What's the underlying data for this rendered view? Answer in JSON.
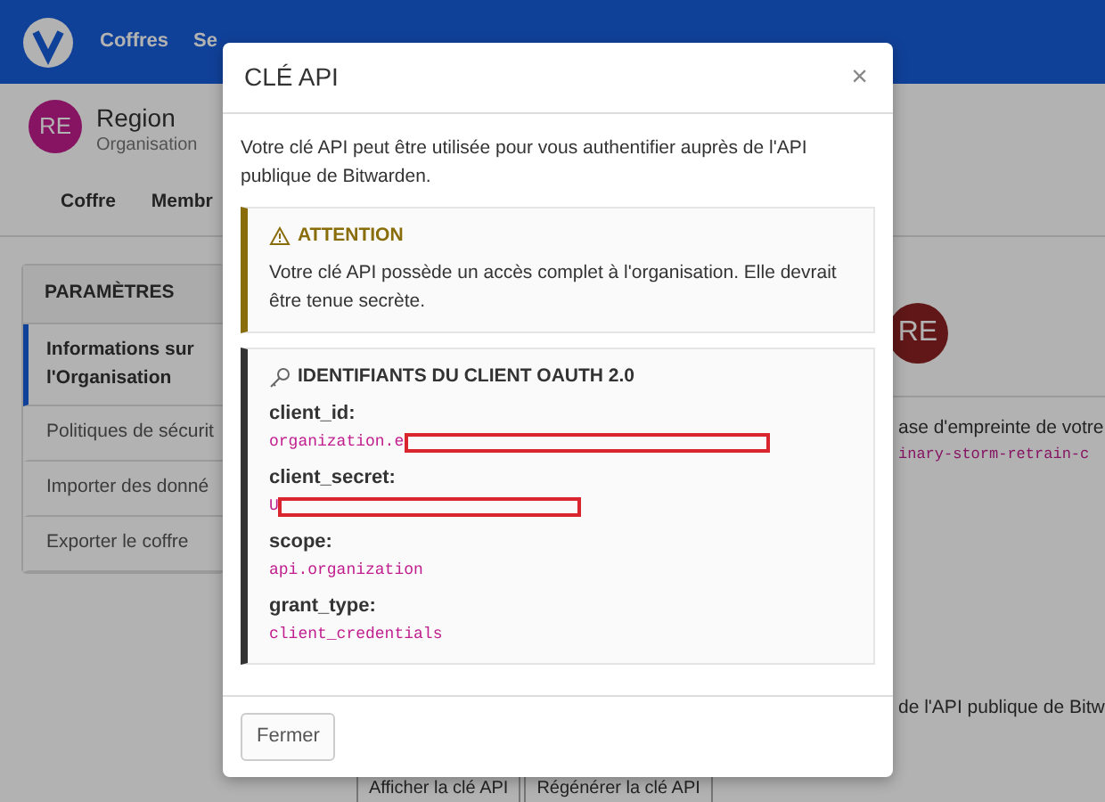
{
  "nav": {
    "items": [
      {
        "label": "Coffres"
      },
      {
        "label": "Se"
      }
    ]
  },
  "org": {
    "initials": "RE",
    "name": "Region",
    "type": "Organisation"
  },
  "tabs": [
    {
      "label": "Coffre"
    },
    {
      "label": "Membr"
    }
  ],
  "sidebar": {
    "title": "PARAMÈTRES",
    "items": [
      {
        "label": "Informations sur l'Organisation",
        "selected": true
      },
      {
        "label": "Politiques de sécurit",
        "selected": false
      },
      {
        "label": "Importer des donné",
        "selected": false
      },
      {
        "label": "Exporter le coffre",
        "selected": false
      }
    ]
  },
  "content": {
    "avatar_initials": "RE",
    "fingerprint_text": "ase d'empreinte de votre",
    "fingerprint": "inary-storm-retrain-c",
    "api_text": "de l'API publique de Bitw",
    "buttons": [
      "Afficher la clé API",
      "Régénérer la clé API"
    ]
  },
  "modal": {
    "title": "CLÉ API",
    "close": "×",
    "intro": "Votre clé API peut être utilisée pour vous authentifier auprès de l'API publique de Bitwarden.",
    "warning": {
      "title": "ATTENTION",
      "text": "Votre clé API possède un accès complet à l'organisation. Elle devrait être tenue secrète."
    },
    "credentials": {
      "title": "IDENTIFIANTS DU CLIENT OAUTH 2.0",
      "fields": [
        {
          "label": "client_id:",
          "value": "organization.e",
          "redacted": true
        },
        {
          "label": "client_secret:",
          "value": "U",
          "redacted": true
        },
        {
          "label": "scope:",
          "value": "api.organization"
        },
        {
          "label": "grant_type:",
          "value": "client_credentials"
        }
      ]
    },
    "footer_button": "Fermer"
  }
}
